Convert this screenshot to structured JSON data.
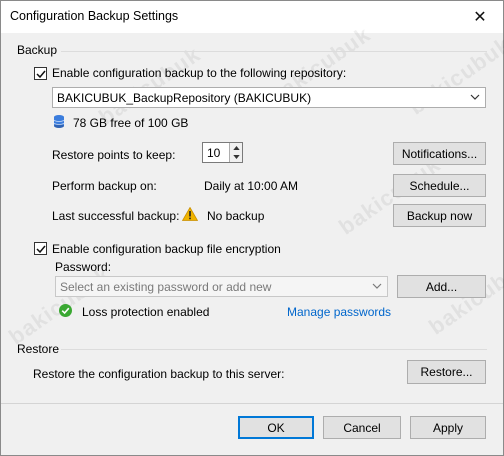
{
  "window": {
    "title": "Configuration Backup Settings"
  },
  "backup": {
    "section_label": "Backup",
    "enable_checkbox_label": "Enable configuration backup to the following repository:",
    "enable_checked": true,
    "repository_value": "BAKICUBUK_BackupRepository (BAKICUBUK)",
    "storage_text": "78 GB free of 100 GB",
    "restore_points_label": "Restore points to keep:",
    "restore_points_value": "10",
    "notifications_button": "Notifications...",
    "perform_label": "Perform backup on:",
    "perform_value": "Daily at 10:00 AM",
    "schedule_button": "Schedule...",
    "last_label": "Last successful backup:",
    "last_value": "No backup",
    "backup_now_button": "Backup now",
    "encryption_checkbox_label": "Enable configuration backup file encryption",
    "encryption_checked": true,
    "password_label": "Password:",
    "password_placeholder": "Select an existing password or add new",
    "add_button": "Add...",
    "loss_protection_text": "Loss protection enabled",
    "manage_passwords_link": "Manage passwords"
  },
  "restore": {
    "section_label": "Restore",
    "restore_text": "Restore the configuration backup to this server:",
    "restore_button": "Restore..."
  },
  "footer": {
    "ok_button": "OK",
    "cancel_button": "Cancel",
    "apply_button": "Apply"
  },
  "watermark": {
    "text": "bakicubuk"
  },
  "colors": {
    "accent": "#0078d7",
    "link": "#0066cc",
    "warning": "#f0b400",
    "success": "#3aa832",
    "storage": "#3b7ddd"
  }
}
